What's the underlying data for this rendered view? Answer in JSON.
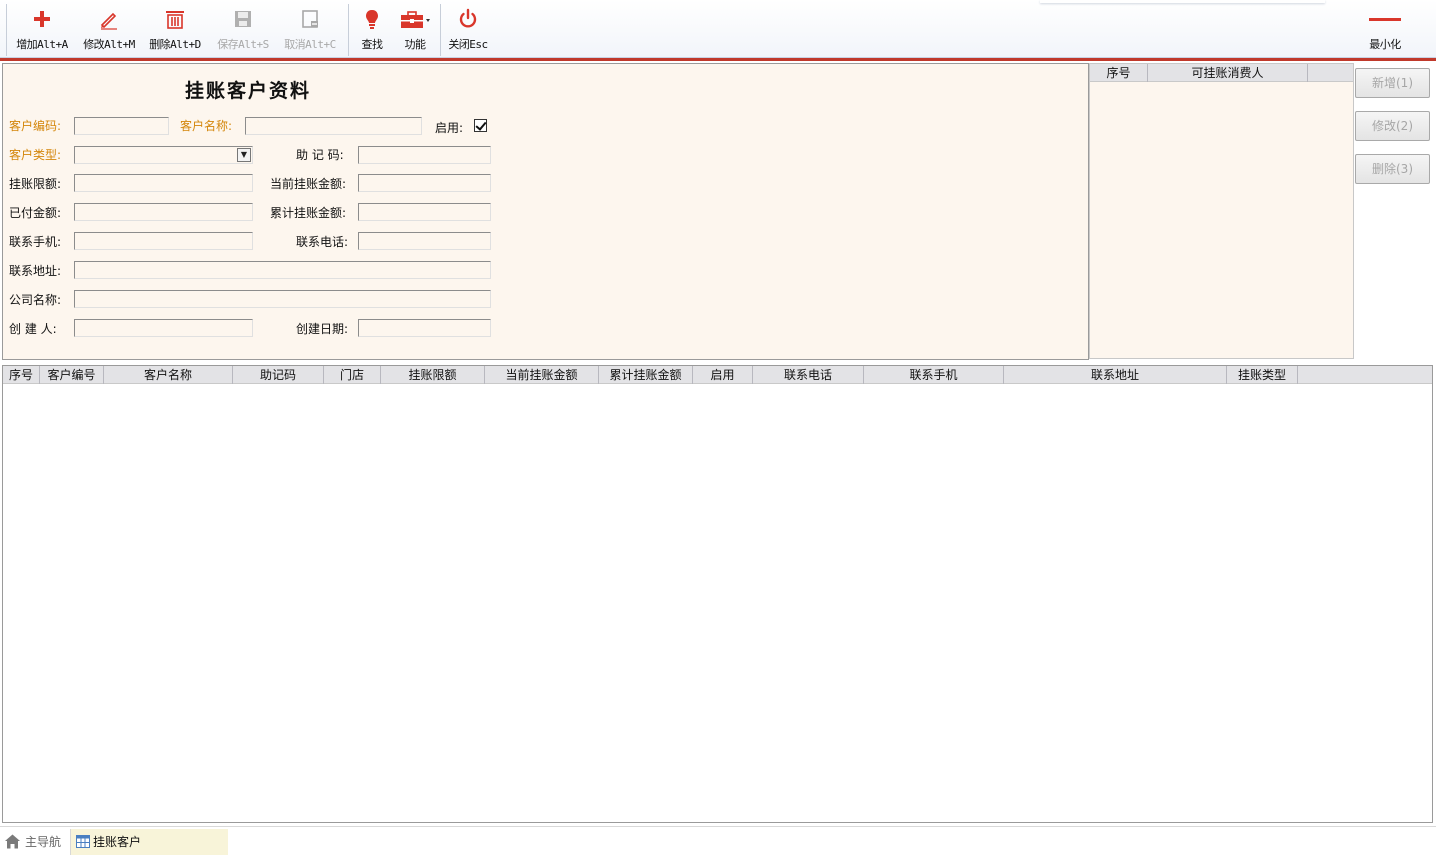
{
  "toolbar": {
    "add": "增加Alt+A",
    "edit": "修改Alt+M",
    "delete": "删除Alt+D",
    "save": "保存Alt+S",
    "cancel": "取消Alt+C",
    "find": "查找",
    "function": "功能",
    "close": "关闭Esc",
    "minimize": "最小化"
  },
  "form": {
    "title": "挂账客户资料",
    "customer_code_label": "客户编码:",
    "customer_name_label": "客户名称:",
    "enabled_label": "启用:",
    "enabled_checked": true,
    "customer_type_label": "客户类型:",
    "mnemonic_label": "助 记 码:",
    "credit_limit_label": "挂账限额:",
    "current_credit_label": "当前挂账金额:",
    "paid_label": "已付金额:",
    "total_credit_label": "累计挂账金额:",
    "mobile_label": "联系手机:",
    "phone_label": "联系电话:",
    "address_label": "联系地址:",
    "company_label": "公司名称:",
    "creator_label": "创 建 人:",
    "created_date_label": "创建日期:"
  },
  "consumer_grid": {
    "columns": [
      "序号",
      "可挂账消费人"
    ]
  },
  "side_buttons": {
    "new": "新增(1)",
    "modify": "修改(2)",
    "remove": "删除(3)"
  },
  "main_grid": {
    "columns": [
      "序号",
      "客户编号",
      "客户名称",
      "助记码",
      "门店",
      "挂账限额",
      "当前挂账金额",
      "累计挂账金额",
      "启用",
      "联系电话",
      "联系手机",
      "联系地址",
      "挂账类型"
    ]
  },
  "bottom_tabs": {
    "home": "主导航",
    "current": "挂账客户"
  },
  "colors": {
    "required_label": "#d4860a",
    "accent_red": "#c0392b",
    "form_bg": "#fdf6ee"
  }
}
